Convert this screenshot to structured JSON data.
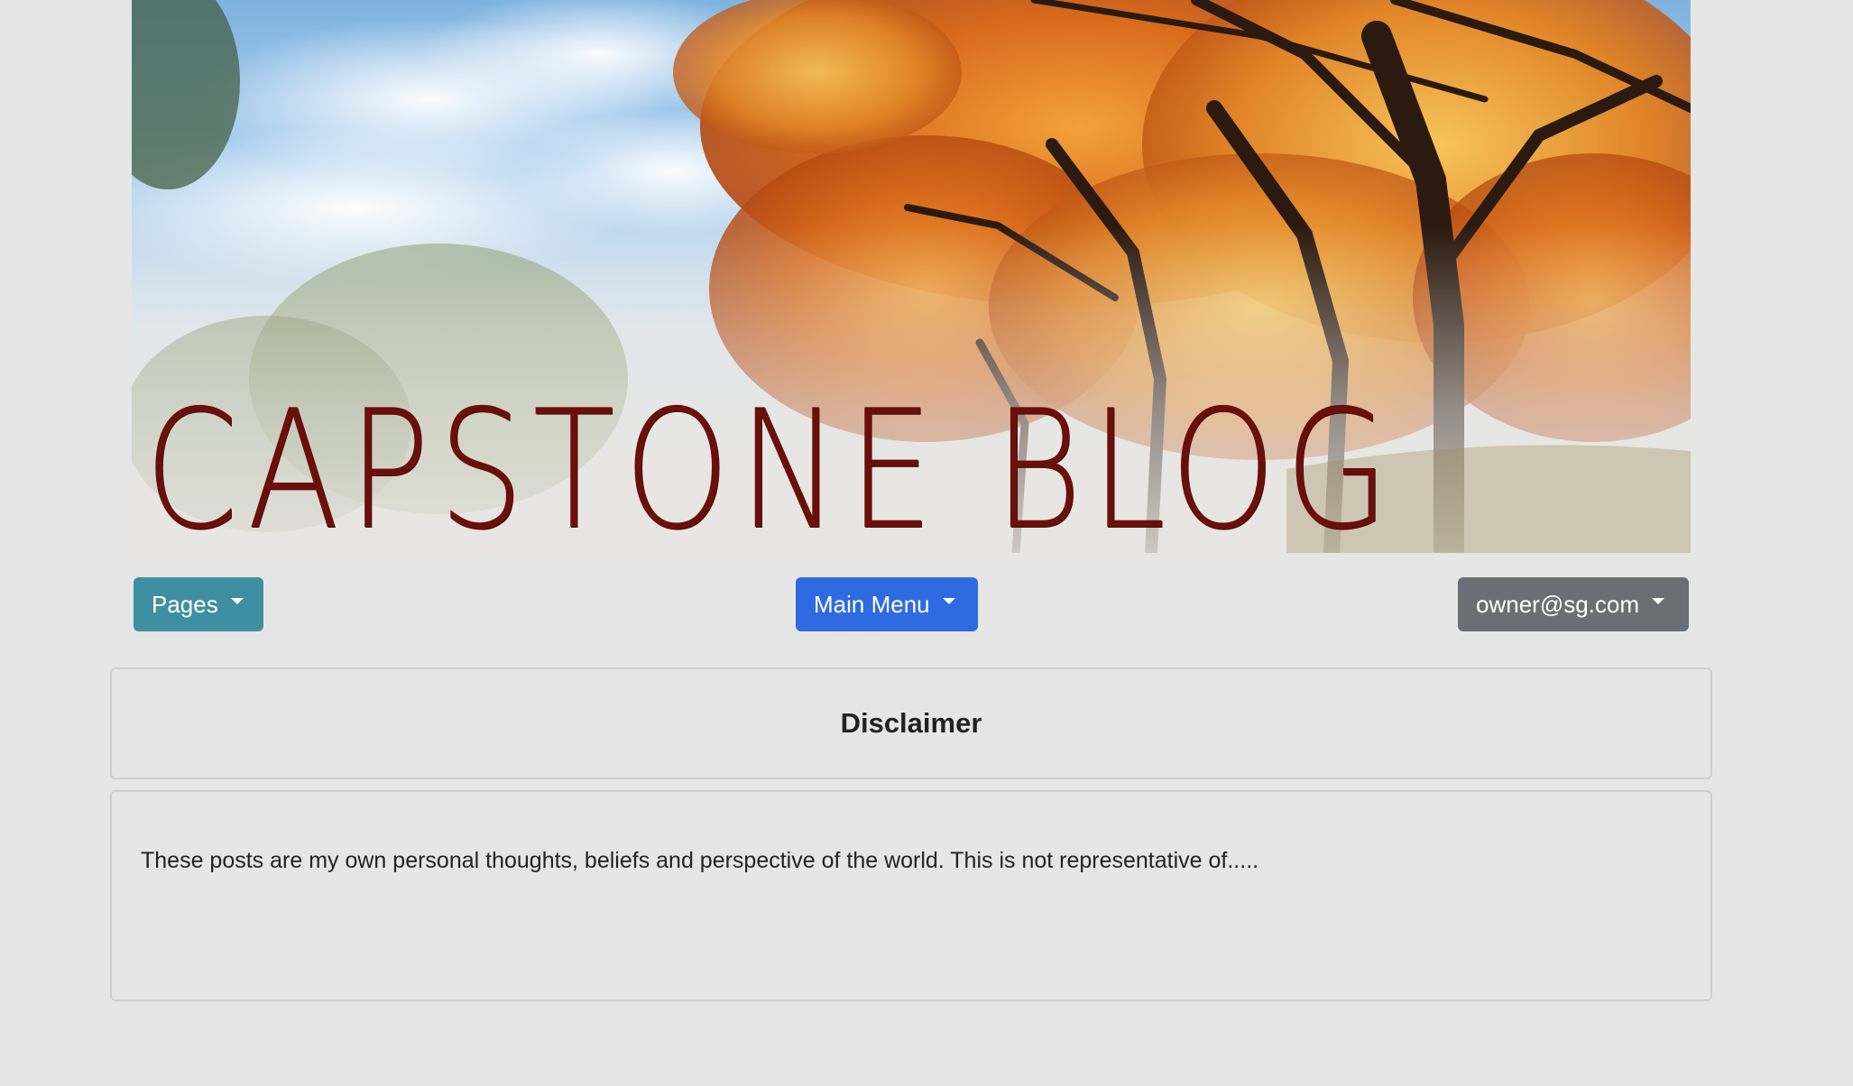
{
  "banner": {
    "title": "CAPSTONE BLOG"
  },
  "nav": {
    "pages_label": "Pages",
    "main_menu_label": "Main Menu",
    "user_label": "owner@sg.com"
  },
  "colors": {
    "pages_button": "#3f8fa2",
    "main_menu_button": "#2f6be0",
    "user_button": "#6b6f75",
    "page_background": "#e6e6e6",
    "banner_title": "#6a0f0a"
  },
  "post": {
    "title": "Disclaimer",
    "body": "These posts are my own personal thoughts, beliefs and perspective of the world. This is not representative of....."
  }
}
